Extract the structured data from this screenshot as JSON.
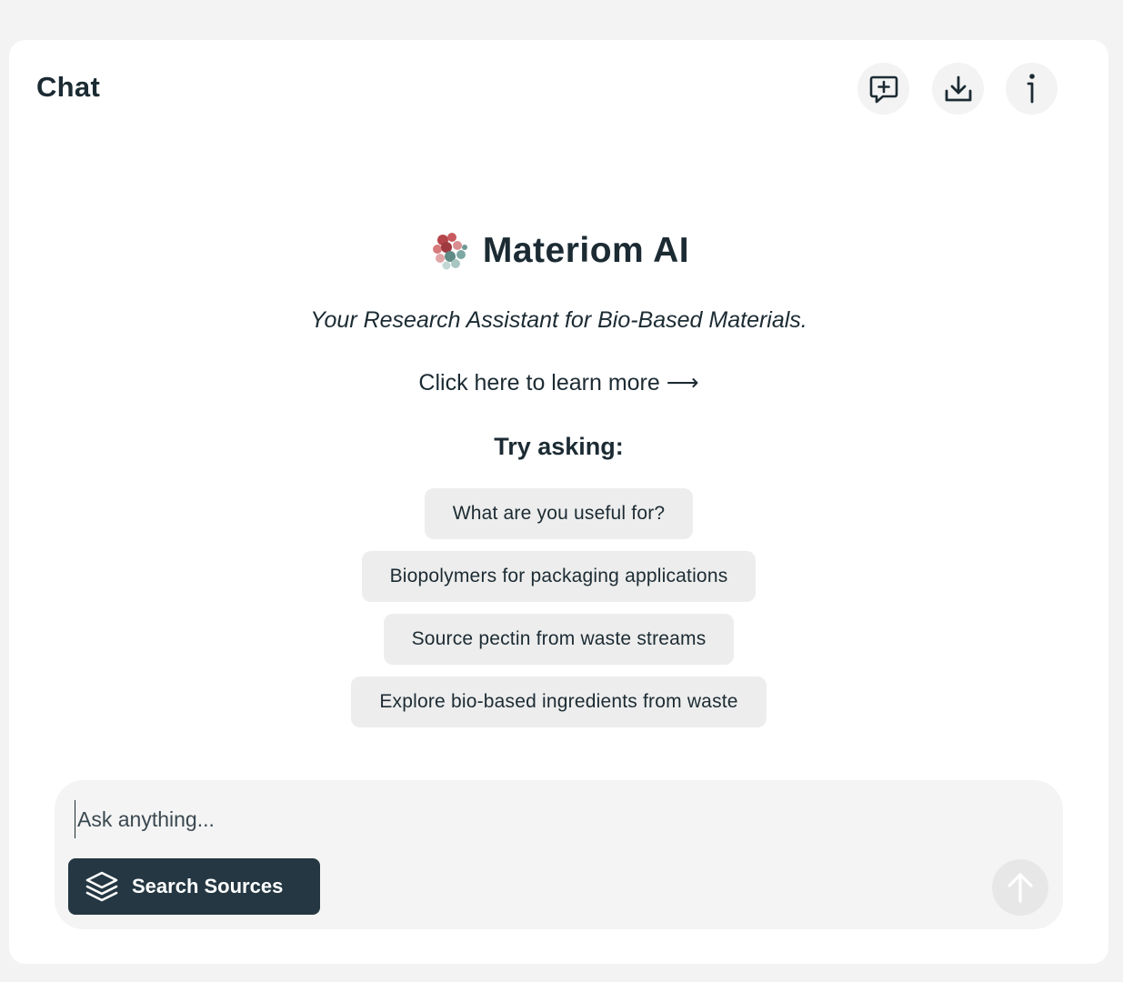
{
  "header": {
    "title": "Chat",
    "icons": [
      "new-chat-icon",
      "download-icon",
      "info-icon"
    ]
  },
  "brand": {
    "name": "Materiom AI",
    "logo_icon": "materiom-logo-icon",
    "tagline": "Your Research Assistant for Bio-Based Materials."
  },
  "learn_more": "Click here to learn more ⟶",
  "try_asking": {
    "heading": "Try asking:",
    "suggestions": [
      "What are you useful for?",
      "Biopolymers for packaging applications",
      "Source pectin from waste streams",
      "Explore bio-based ingredients from waste"
    ]
  },
  "composer": {
    "placeholder": "Ask anything...",
    "value": "",
    "search_sources_label": "Search Sources",
    "search_sources_icon": "layers-icon",
    "send_icon": "arrow-up-icon"
  },
  "colors": {
    "text": "#1c2b33",
    "button_dark": "#243742",
    "chip_bg": "#ededed",
    "page_bg": "#f3f3f3"
  }
}
